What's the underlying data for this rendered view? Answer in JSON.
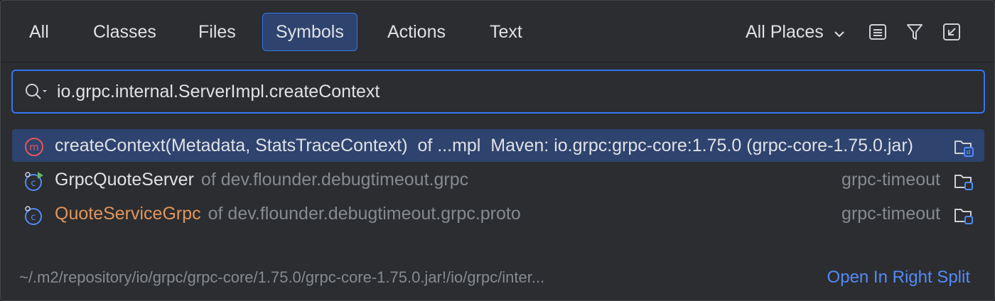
{
  "tabs": [
    {
      "label": "All"
    },
    {
      "label": "Classes"
    },
    {
      "label": "Files"
    },
    {
      "label": "Symbols",
      "active": true
    },
    {
      "label": "Actions"
    },
    {
      "label": "Text"
    }
  ],
  "scope": {
    "label": "All Places"
  },
  "toolbar": {
    "icons": [
      "preview-icon",
      "filter-icon",
      "collapse-icon"
    ]
  },
  "search": {
    "value": "io.grpc.internal.ServerImpl.createContext"
  },
  "results": [
    {
      "icon": "method-icon",
      "name": "createContext(Metadata, StatsTraceContext)",
      "location": "of ...mpl",
      "extra": "Maven: io.grpc:grpc-core:1.75.0 (grpc-core-1.75.0.jar)",
      "selected": true
    },
    {
      "icon": "runnable-class-icon",
      "name": "GrpcQuoteServer",
      "location": "of dev.flounder.debugtimeout.grpc",
      "module": "grpc-timeout"
    },
    {
      "icon": "class-icon",
      "name": "QuoteServiceGrpc",
      "location": "of dev.flounder.debugtimeout.grpc.proto",
      "module": "grpc-timeout"
    }
  ],
  "colors": {
    "accent": "#3574f0",
    "selection": "#2e436e",
    "orange_name": "#e0955c",
    "link": "#548af7"
  },
  "footer": {
    "path": "~/.m2/repository/io/grpc/grpc-core/1.75.0/grpc-core-1.75.0.jar!/io/grpc/inter...",
    "open_link": "Open In Right Split"
  }
}
